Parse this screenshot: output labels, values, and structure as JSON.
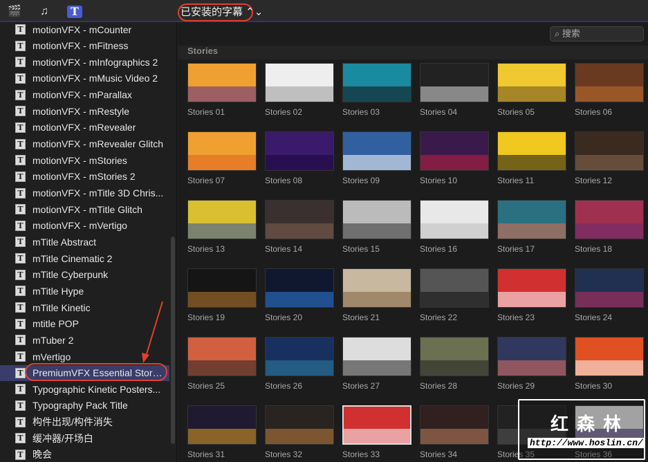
{
  "toolbar": {
    "icons": [
      "clapper-star-icon",
      "music-photo-icon",
      "titles-icon"
    ],
    "titles_icon_glyph": "T",
    "library_select": "已安装的字幕 ⌃⌄"
  },
  "search": {
    "placeholder": "搜索",
    "icon": "magnifier-icon"
  },
  "sidebar": {
    "selected_index": 21,
    "items": [
      "motionVFX - mCounter",
      "motionVFX - mFitness",
      "motionVFX - mInfographics 2",
      "motionVFX - mMusic Video 2",
      "motionVFX - mParallax",
      "motionVFX - mRestyle",
      "motionVFX - mRevealer",
      "motionVFX - mRevealer Glitch",
      "motionVFX - mStories",
      "motionVFX - mStories 2",
      "motionVFX - mTitle 3D Chris...",
      "motionVFX - mTitle Glitch",
      "motionVFX - mVertigo",
      "mTitle Abstract",
      "mTitle Cinematic 2",
      "mTitle Cyberpunk",
      "mTitle Hype",
      "mTitle Kinetic",
      "mtitle POP",
      "mTuber 2",
      "mVertigo",
      "PremiumVFX Essential Stories",
      "Typographic Kinetic Posters...",
      "Typography Pack Title",
      "构件出现/构件消失",
      "缓冲器/开场白",
      "晚会"
    ]
  },
  "section": {
    "title": "Stories"
  },
  "grid": {
    "selected_index": 32,
    "items": [
      {
        "label": "Stories 01",
        "color": "#f0a030",
        "band": "#5a2a8a"
      },
      {
        "label": "Stories 02",
        "color": "#eeeeee",
        "band": "#999999"
      },
      {
        "label": "Stories 03",
        "color": "#1a8aa0",
        "band": "#111111"
      },
      {
        "label": "Stories 04",
        "color": "#222222",
        "band": "#dddddd"
      },
      {
        "label": "Stories 05",
        "color": "#f0c830",
        "band": "#6a5020"
      },
      {
        "label": "Stories 06",
        "color": "#6a3a20",
        "band": "#c07030"
      },
      {
        "label": "Stories 07",
        "color": "#f0a030",
        "band": "#e06020"
      },
      {
        "label": "Stories 08",
        "color": "#3a1a6a",
        "band": "#1a0a3a"
      },
      {
        "label": "Stories 09",
        "color": "#3060a0",
        "band": "#ffffff"
      },
      {
        "label": "Stories 10",
        "color": "#3a1a4a",
        "band": "#c02040"
      },
      {
        "label": "Stories 11",
        "color": "#f0c820",
        "band": "#111111"
      },
      {
        "label": "Stories 12",
        "color": "#3a2a20",
        "band": "#8a6a50"
      },
      {
        "label": "Stories 13",
        "color": "#d8c030",
        "band": "#3050a0"
      },
      {
        "label": "Stories 14",
        "color": "#3a3030",
        "band": "#806050"
      },
      {
        "label": "Stories 15",
        "color": "#bbbbbb",
        "band": "#333333"
      },
      {
        "label": "Stories 16",
        "color": "#e8e8e8",
        "band": "#bbbbbb"
      },
      {
        "label": "Stories 17",
        "color": "#2a7080",
        "band": "#e07050"
      },
      {
        "label": "Stories 18",
        "color": "#a03050",
        "band": "#6a2a70"
      },
      {
        "label": "Stories 19",
        "color": "#151515",
        "band": "#c08030"
      },
      {
        "label": "Stories 20",
        "color": "#101830",
        "band": "#3080e0"
      },
      {
        "label": "Stories 21",
        "color": "#c8b8a0",
        "band": "#806040"
      },
      {
        "label": "Stories 22",
        "color": "#555555",
        "band": "#111111"
      },
      {
        "label": "Stories 23",
        "color": "#d03030",
        "band": "#ffffff"
      },
      {
        "label": "Stories 24",
        "color": "#203050",
        "band": "#c03060"
      },
      {
        "label": "Stories 25",
        "color": "#d06040",
        "band": "#222222"
      },
      {
        "label": "Stories 26",
        "color": "#183060",
        "band": "#3080a0"
      },
      {
        "label": "Stories 27",
        "color": "#dddddd",
        "band": "#222222"
      },
      {
        "label": "Stories 28",
        "color": "#6a7050",
        "band": "#222222"
      },
      {
        "label": "Stories 29",
        "color": "#303860",
        "band": "#e07060"
      },
      {
        "label": "Stories 30",
        "color": "#e05020",
        "band": "#ffffff"
      },
      {
        "label": "Stories 31",
        "color": "#201a30",
        "band": "#e0a020"
      },
      {
        "label": "Stories 32",
        "color": "#2a2420",
        "band": "#c08040"
      },
      {
        "label": "Stories 33",
        "color": "#d03030",
        "band": "#ffffff"
      },
      {
        "label": "Stories 34",
        "color": "#302020",
        "band": "#c08060"
      },
      {
        "label": "Stories 35",
        "color": "#222222",
        "band": "#555555"
      },
      {
        "label": "Stories 36",
        "color": "#eeeeee",
        "band": "#3a2070"
      }
    ]
  },
  "watermark": {
    "title": "红森林",
    "url": "http://www.hoslin.cn/"
  },
  "annotation_color": "#e2402a"
}
